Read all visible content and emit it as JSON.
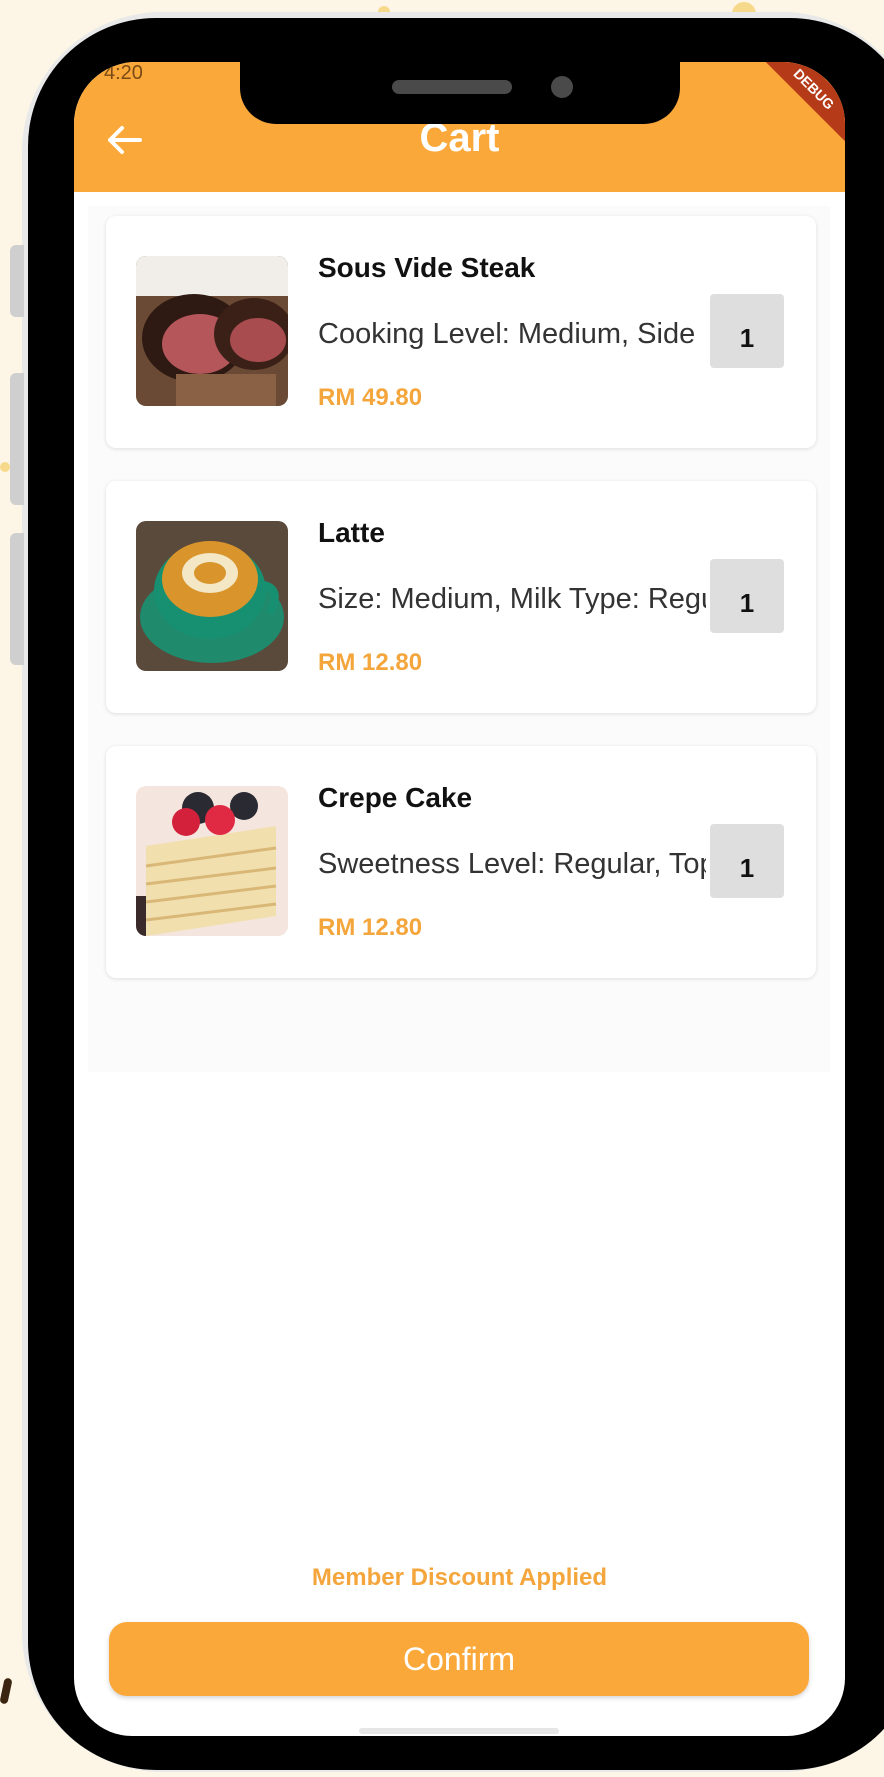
{
  "appbar": {
    "title": "Cart",
    "status_time": "4:20",
    "debug_label": "DEBUG",
    "accent_color": "#fba83a"
  },
  "cart": {
    "items": [
      {
        "name": "Sous Vide Steak",
        "options": "Cooking Level: Medium, Side",
        "price": "RM 49.80",
        "quantity": "1",
        "image_icon": "steak-image"
      },
      {
        "name": "Latte",
        "options": "Size: Medium, Milk Type: Regular",
        "price": "RM 12.80",
        "quantity": "1",
        "image_icon": "latte-image"
      },
      {
        "name": "Crepe Cake",
        "options": "Sweetness Level: Regular, Topping",
        "price": "RM 12.80",
        "quantity": "1",
        "image_icon": "crepe-cake-image"
      }
    ]
  },
  "footer": {
    "discount_text": "Member Discount Applied",
    "confirm_label": "Confirm"
  },
  "icons": {
    "back": "back-arrow-icon"
  }
}
